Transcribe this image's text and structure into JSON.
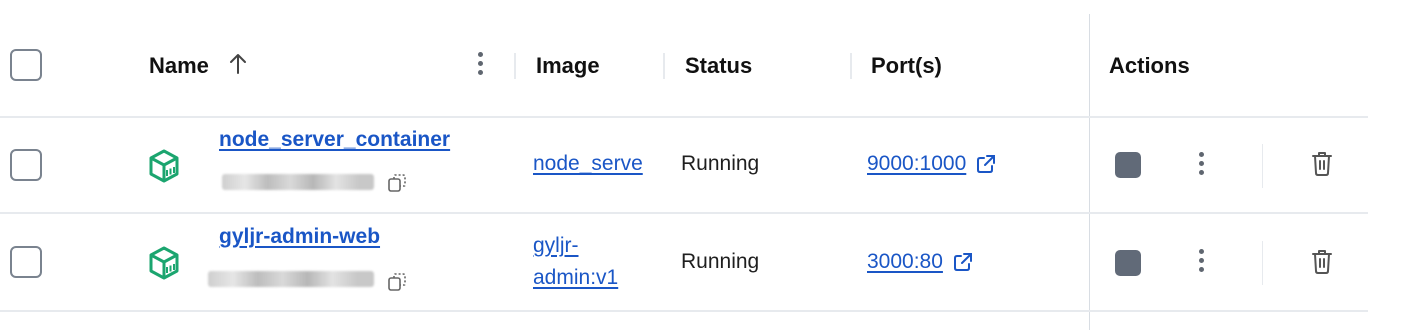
{
  "header": {
    "name_label": "Name",
    "image_label": "Image",
    "status_label": "Status",
    "ports_label": "Port(s)",
    "actions_label": "Actions"
  },
  "rows": [
    {
      "name": "node_server_container",
      "image": "node_serve",
      "status": "Running",
      "port": "9000:1000"
    },
    {
      "name": "gyljr-admin-web",
      "image_line1": "gyljr-",
      "image_line2": "admin:v1",
      "status": "Running",
      "port": "3000:80"
    }
  ],
  "icons": {
    "sort": "arrow-up-icon",
    "container": "container-cube-icon",
    "copy": "copy-icon",
    "external": "external-link-icon",
    "stop": "stop-icon",
    "more": "more-vertical-icon",
    "delete": "trash-icon"
  },
  "colors": {
    "link": "#1a56c6",
    "container_icon": "#1ba56f",
    "stop_button": "#616a78"
  }
}
